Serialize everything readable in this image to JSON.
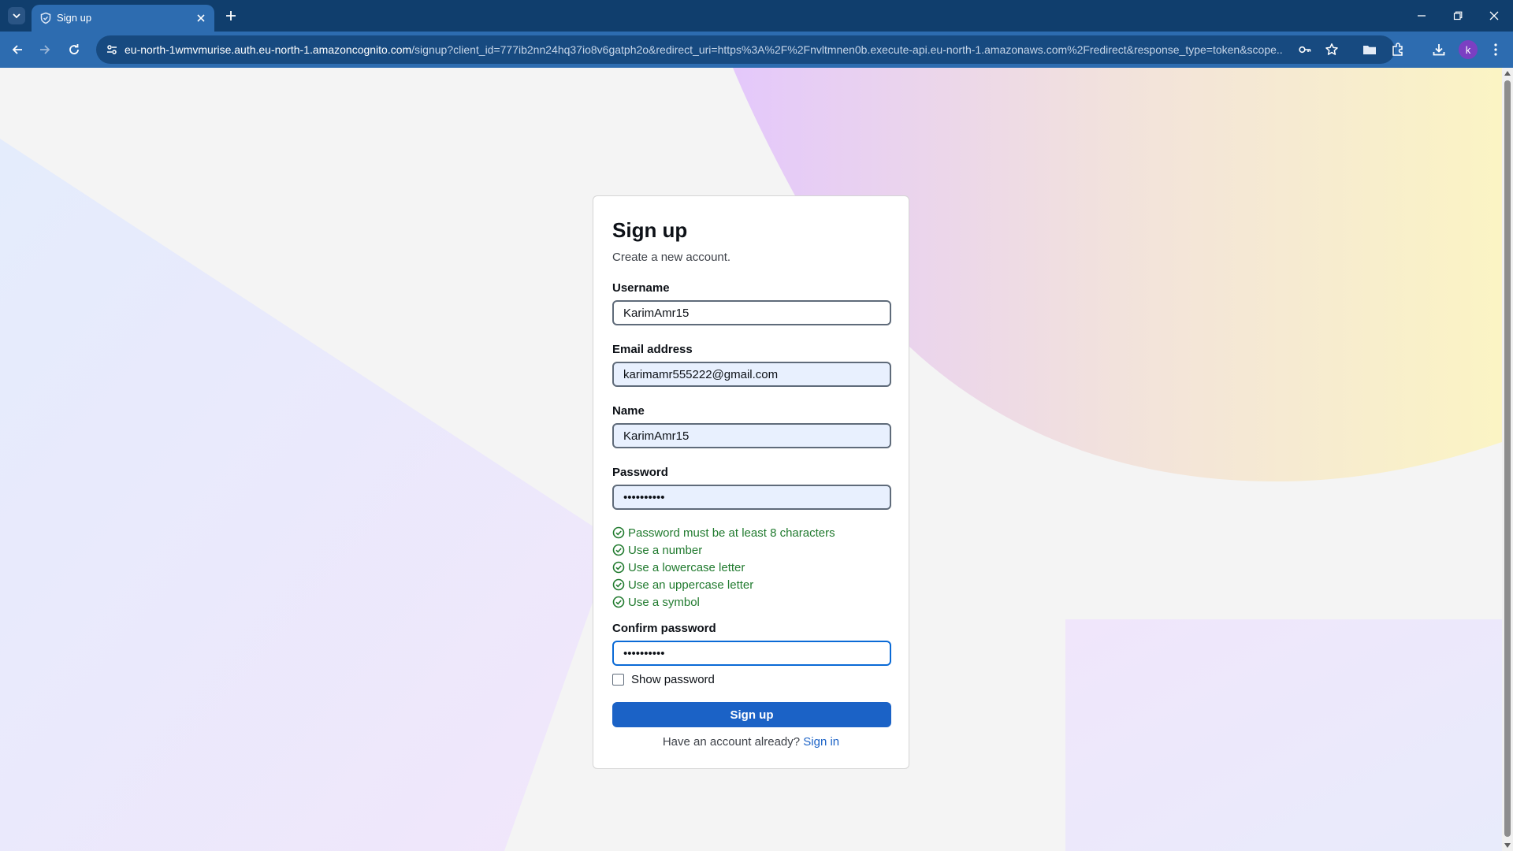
{
  "browser": {
    "tab_title": "Sign up",
    "url_host": "eu-north-1wmvmurise.auth.eu-north-1.amazoncognito.com",
    "url_rest": "/signup?client_id=777ib2nn24hq37io8v6gatph2o&redirect_uri=https%3A%2F%2Fnvltmnen0b.execute-api.eu-north-1.amazonaws.com%2Fredirect&response_type=token&scope...",
    "profile_initial": "k"
  },
  "form": {
    "title": "Sign up",
    "subtitle": "Create a new account.",
    "username_label": "Username",
    "username_value": "KarimAmr15",
    "email_label": "Email address",
    "email_value": "karimamr555222@gmail.com",
    "name_label": "Name",
    "name_value": "KarimAmr15",
    "password_label": "Password",
    "password_value": "••••••••••",
    "requirements": [
      "Password must be at least 8 characters",
      "Use a number",
      "Use a lowercase letter",
      "Use an uppercase letter",
      "Use a symbol"
    ],
    "confirm_label": "Confirm password",
    "confirm_value": "••••••••••",
    "show_password_label": "Show password",
    "submit_label": "Sign up",
    "signin_prompt": "Have an account already?",
    "signin_link": "Sign in"
  },
  "colors": {
    "tabbar": "#103e6d",
    "toolbar": "#2d6cb0",
    "primary_button": "#1b62c6",
    "requirement_ok": "#207a2e"
  },
  "icons": {
    "tab_favicon": "shield-icon",
    "requirement": "check-circle-icon"
  }
}
